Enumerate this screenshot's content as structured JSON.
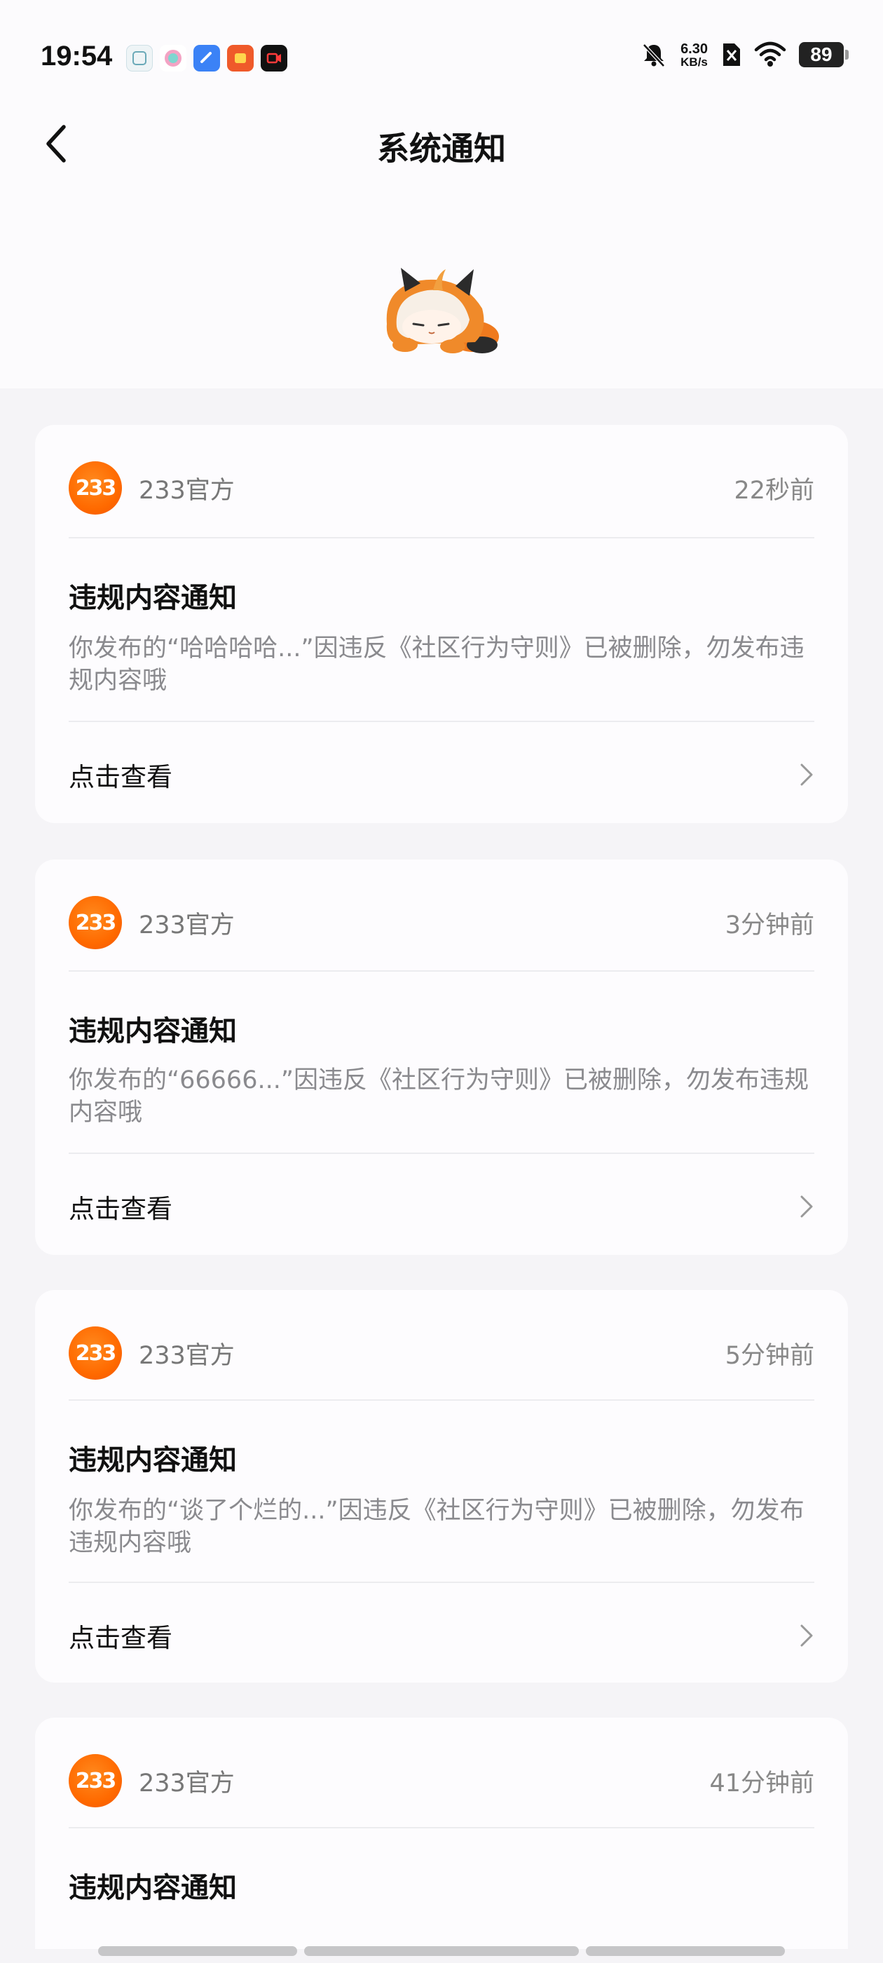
{
  "status_bar": {
    "time": "19:54",
    "app_icons": [
      "app-icon-1",
      "app-icon-2",
      "app-icon-3",
      "app-icon-4",
      "app-icon-5"
    ],
    "speed_value": "6.30",
    "speed_unit": "KB/s",
    "battery": "89"
  },
  "header": {
    "title": "系统通知"
  },
  "notifications": [
    {
      "logo_text": "233",
      "sender": "233官方",
      "time": "22秒前",
      "title": "违规内容通知",
      "body": "你发布的“哈哈哈哈...”因违反《社区行为守则》已被删除，勿发布违规内容哦",
      "link": "点击查看"
    },
    {
      "logo_text": "233",
      "sender": "233官方",
      "time": "3分钟前",
      "title": "违规内容通知",
      "body": "你发布的“66666...”因违反《社区行为守则》已被删除，勿发布违规内容哦",
      "link": "点击查看"
    },
    {
      "logo_text": "233",
      "sender": "233官方",
      "time": "5分钟前",
      "title": "违规内容通知",
      "body": "你发布的“谈了个烂的...”因违反《社区行为守则》已被删除，勿发布违规内容哦",
      "link": "点击查看"
    },
    {
      "logo_text": "233",
      "sender": "233官方",
      "time": "41分钟前",
      "title": "违规内容通知"
    }
  ],
  "colors": {
    "brand_orange": "#ff6a00",
    "background": "#f5f4f7",
    "card": "#fdfcfe"
  }
}
